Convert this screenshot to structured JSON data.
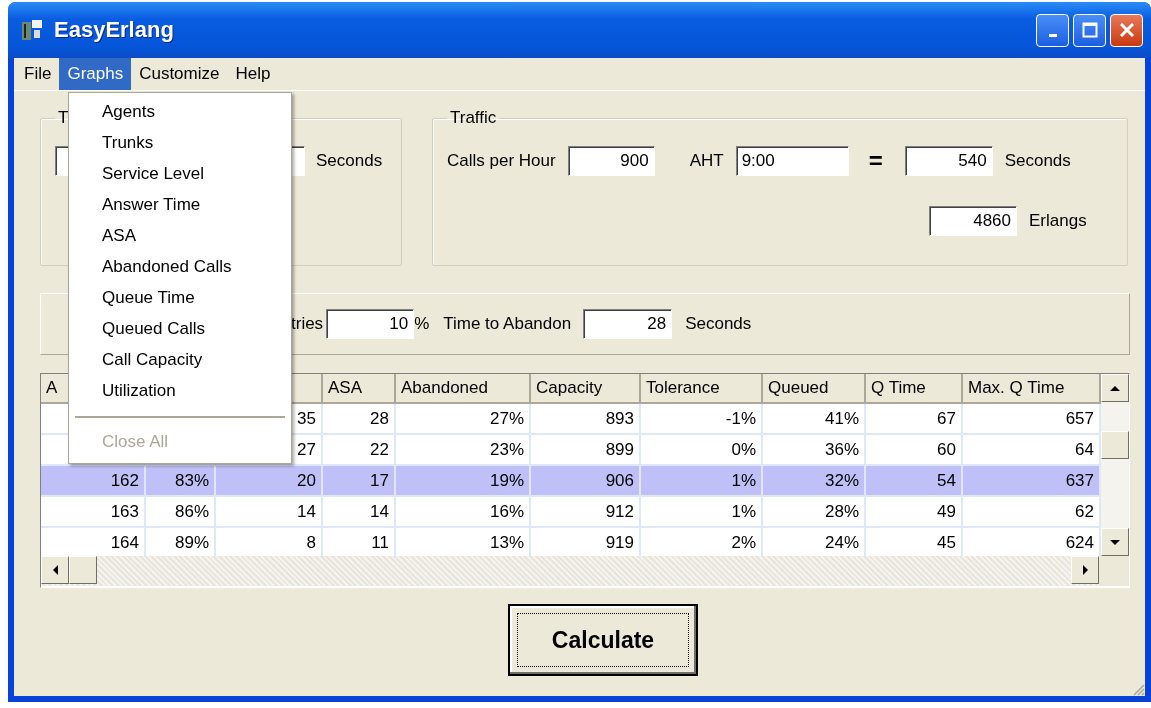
{
  "window": {
    "title": "EasyErlang"
  },
  "menu_bar": [
    {
      "label": "File",
      "selected": false
    },
    {
      "label": "Graphs",
      "selected": true
    },
    {
      "label": "Customize",
      "selected": false
    },
    {
      "label": "Help",
      "selected": false
    }
  ],
  "graphs_menu": [
    {
      "kind": "item",
      "label": "Agents",
      "disabled": false
    },
    {
      "kind": "item",
      "label": "Trunks",
      "disabled": false
    },
    {
      "kind": "item",
      "label": "Service Level",
      "disabled": false
    },
    {
      "kind": "item",
      "label": "Answer Time",
      "disabled": false
    },
    {
      "kind": "item",
      "label": "ASA",
      "disabled": false
    },
    {
      "kind": "item",
      "label": "Abandoned Calls",
      "disabled": false
    },
    {
      "kind": "item",
      "label": "Queue Time",
      "disabled": false
    },
    {
      "kind": "item",
      "label": "Queued Calls",
      "disabled": false
    },
    {
      "kind": "item",
      "label": "Call Capacity",
      "disabled": false
    },
    {
      "kind": "item",
      "label": "Utilization",
      "disabled": false
    },
    {
      "kind": "separator"
    },
    {
      "kind": "item",
      "label": "Close All",
      "disabled": true
    }
  ],
  "time_group": {
    "title": "T",
    "unit": "Seconds"
  },
  "traffic": {
    "title": "Traffic",
    "calls_label": "Calls per Hour",
    "calls": "900",
    "aht_label": "AHT",
    "aht": "9:00",
    "equals": "=",
    "seconds": "540",
    "seconds_unit": "Seconds",
    "erlangs": "4860",
    "erlangs_unit": "Erlangs"
  },
  "abandon_panel": {
    "retries_label": "tries",
    "retries": "10",
    "retries_unit": "%",
    "abandon_label": "Time to Abandon",
    "abandon": "28",
    "abandon_unit": "Seconds"
  },
  "table": {
    "columns": [
      "A",
      null,
      null,
      "ASA",
      "Abandoned",
      "Capacity",
      "Tolerance",
      "Queued",
      "Q Time",
      "Max. Q Time"
    ],
    "rows": [
      {
        "selected": false,
        "cells": [
          null,
          null,
          "35",
          "28",
          "27%",
          "893",
          "-1%",
          "41%",
          "67",
          "657"
        ]
      },
      {
        "selected": false,
        "cells": [
          null,
          null,
          "27",
          "22",
          "23%",
          "899",
          "0%",
          "36%",
          "60",
          "64"
        ]
      },
      {
        "selected": true,
        "cells": [
          "162",
          "83%",
          "20",
          "17",
          "19%",
          "906",
          "1%",
          "32%",
          "54",
          "637"
        ]
      },
      {
        "selected": false,
        "cells": [
          "163",
          "86%",
          "14",
          "14",
          "16%",
          "912",
          "1%",
          "28%",
          "49",
          "62"
        ]
      },
      {
        "selected": false,
        "cells": [
          "164",
          "89%",
          "8",
          "11",
          "13%",
          "919",
          "2%",
          "24%",
          "45",
          "624"
        ]
      }
    ]
  },
  "calculate_button": "Calculate"
}
